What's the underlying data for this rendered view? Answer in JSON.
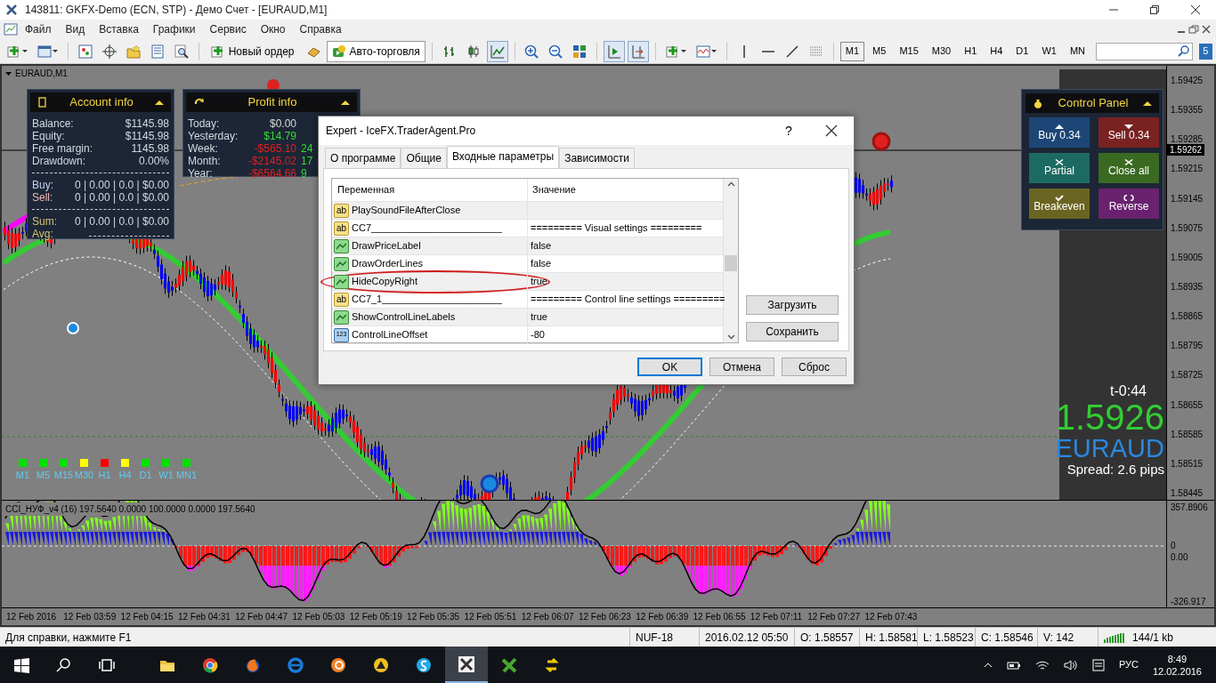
{
  "window": {
    "title": "143811: GKFX-Demo (ECN, STP) - Демо Счет - [EURAUD,M1]"
  },
  "menu": [
    "Файл",
    "Вид",
    "Вставка",
    "Графики",
    "Сервис",
    "Окно",
    "Справка"
  ],
  "toolbar": {
    "new_order": "Новый ордер",
    "auto_trading": "Авто-торговля",
    "chart_modes": [
      {
        "selected": false
      },
      {
        "selected": false
      },
      {
        "selected": true
      }
    ],
    "autoscroll": {
      "on": true
    },
    "chart_shift": {
      "on": true
    },
    "timeframes": [
      {
        "label": "M1",
        "selected": true
      },
      {
        "label": "M5",
        "selected": false
      },
      {
        "label": "M15",
        "selected": false
      },
      {
        "label": "M30",
        "selected": false
      },
      {
        "label": "H1",
        "selected": false
      },
      {
        "label": "H4",
        "selected": false
      },
      {
        "label": "D1",
        "selected": false
      },
      {
        "label": "W1",
        "selected": false
      },
      {
        "label": "MN",
        "selected": false
      }
    ],
    "notification_count": "5"
  },
  "chart": {
    "symbol_label": "EURAUD,M1",
    "price_scale": [
      "1.59425",
      "1.59355",
      "1.59285",
      "1.59215",
      "1.59145",
      "1.59075",
      "1.59005",
      "1.58935",
      "1.58865",
      "1.58795",
      "1.58725",
      "1.58655",
      "1.58585",
      "1.58515",
      "1.58445"
    ],
    "current_price": "1.59262",
    "timer": "t-0:44",
    "bid": "1.5926",
    "symbol": "EURAUD",
    "spread": "Spread: 2.6 pips",
    "timeframe_signals": [
      {
        "label": "M1",
        "color": "#00e000"
      },
      {
        "label": "M5",
        "color": "#00e000"
      },
      {
        "label": "M15",
        "color": "#00e000"
      },
      {
        "label": "M30",
        "color": "#ffff00"
      },
      {
        "label": "H1",
        "color": "#ff0000"
      },
      {
        "label": "H4",
        "color": "#ffff00"
      },
      {
        "label": "D1",
        "color": "#00e000"
      },
      {
        "label": "W1",
        "color": "#00e000"
      },
      {
        "label": "MN1",
        "color": "#00e000"
      }
    ]
  },
  "account_info": {
    "title": "Account info",
    "rows": [
      {
        "label": "Balance:",
        "value": "$1145.98",
        "kind": "plain"
      },
      {
        "label": "Equity:",
        "value": "$1145.98",
        "kind": "plain"
      },
      {
        "label": "Free margin:",
        "value": "1145.98",
        "kind": "plain"
      },
      {
        "label": "Drawdown:",
        "value": "0.00%",
        "kind": "plain"
      },
      {
        "kind": "separator"
      },
      {
        "label": "Buy:",
        "value": "0 | 0.00 | 0.0 | $0.00",
        "kind": "buy"
      },
      {
        "label": "Sell:",
        "value": "0 | 0.00 | 0.0 | $0.00",
        "kind": "sell"
      },
      {
        "kind": "separator"
      },
      {
        "label": "Sum:",
        "value": "0 | 0.00 | 0.0 | $0.00",
        "kind": "total"
      },
      {
        "label": "Avg:",
        "kind": "total"
      }
    ]
  },
  "profit_info": {
    "title": "Profit info",
    "rows": [
      {
        "label": "Today:",
        "value": "$0.00",
        "color": "#d8d8d8"
      },
      {
        "label": "Yesterday:",
        "value": "$14.79",
        "color": "#33dd33"
      },
      {
        "label": "Week:",
        "value": "-$565.10",
        "color": "#e02020",
        "extra": "24"
      },
      {
        "label": "Month:",
        "value": "-$2145.02",
        "color": "#e02020",
        "extra": "17"
      },
      {
        "label": "Year:",
        "value": "-$6564.66",
        "color": "#e02020",
        "extra": "9"
      }
    ]
  },
  "control_panel": {
    "title": "Control Panel",
    "buttons": [
      {
        "label": "Buy 0.34",
        "kind": "buy",
        "color": "#1d4677"
      },
      {
        "label": "Sell 0.34",
        "kind": "sell",
        "color": "#7a2222"
      },
      {
        "label": "Partial",
        "kind": "close",
        "color": "#1d6a64"
      },
      {
        "label": "Close all",
        "kind": "close",
        "color": "#3a6a22"
      },
      {
        "label": "Breakeven",
        "kind": "check",
        "color": "#6a6422"
      },
      {
        "label": "Reverse",
        "kind": "reverse",
        "color": "#6a2270"
      }
    ]
  },
  "indicator": {
    "label": "CCI_НУФ_v4 (16) 197.5640 0.0000 100.0000 0.0000 197.5640",
    "scale": [
      "357.8906",
      "0",
      "0.00",
      "-326.917"
    ]
  },
  "time_axis": [
    "12 Feb 2016",
    "12 Feb 03:59",
    "12 Feb 04:15",
    "12 Feb 04:31",
    "12 Feb 04:47",
    "12 Feb 05:03",
    "12 Feb 05:19",
    "12 Feb 05:35",
    "12 Feb 05:51",
    "12 Feb 06:07",
    "12 Feb 06:23",
    "12 Feb 06:39",
    "12 Feb 06:55",
    "12 Feb 07:11",
    "12 Feb 07:27",
    "12 Feb 07:43"
  ],
  "dialog": {
    "title": "Expert - IceFX.TraderAgent.Pro",
    "help": "?",
    "tabs": [
      {
        "label": "О программе",
        "selected": false
      },
      {
        "label": "Общие",
        "selected": false
      },
      {
        "label": "Входные параметры",
        "selected": true
      },
      {
        "label": "Зависимости",
        "selected": false
      }
    ],
    "columns": [
      "Переменная",
      "Значение"
    ],
    "rows": [
      {
        "name": "PlaySoundFileAfterClose",
        "kind": "string",
        "icon_text": "ab",
        "circled": false
      },
      {
        "name": "CC7________________________",
        "value": "========= Visual settings =========",
        "kind": "string",
        "icon_text": "ab",
        "circled": false
      },
      {
        "name": "DrawPriceLabel",
        "value": "false",
        "kind": "bool",
        "circled": false
      },
      {
        "name": "DrawOrderLines",
        "value": "false",
        "kind": "bool",
        "circled": false
      },
      {
        "name": "HideCopyRight",
        "value": "true",
        "kind": "bool",
        "circled": true
      },
      {
        "name": "CC7_1______________________",
        "value": "========= Control line settings =========",
        "kind": "string",
        "icon_text": "ab",
        "circled": false
      },
      {
        "name": "ShowControlLineLabels",
        "value": "true",
        "kind": "bool",
        "circled": false
      },
      {
        "name": "ControlLineOffset",
        "value": "-80",
        "kind": "int",
        "icon_text": "123",
        "circled": false
      }
    ],
    "side_buttons": [
      "Загрузить",
      "Сохранить"
    ],
    "buttons": [
      {
        "label": "OK",
        "default": true
      },
      {
        "label": "Отмена",
        "default": false
      },
      {
        "label": "Сброс",
        "default": false
      }
    ]
  },
  "status_bar": {
    "help": "Для справки, нажмите F1",
    "cells": [
      "NUF-18",
      "2016.02.12 05:50",
      "O: 1.58557",
      "H: 1.58581",
      "L: 1.58523",
      "C: 1.58546",
      "V: 142",
      "144/1 kb"
    ]
  },
  "taskbar": {
    "language": "РУС",
    "time": "8:49",
    "date": "12.02.2016"
  }
}
